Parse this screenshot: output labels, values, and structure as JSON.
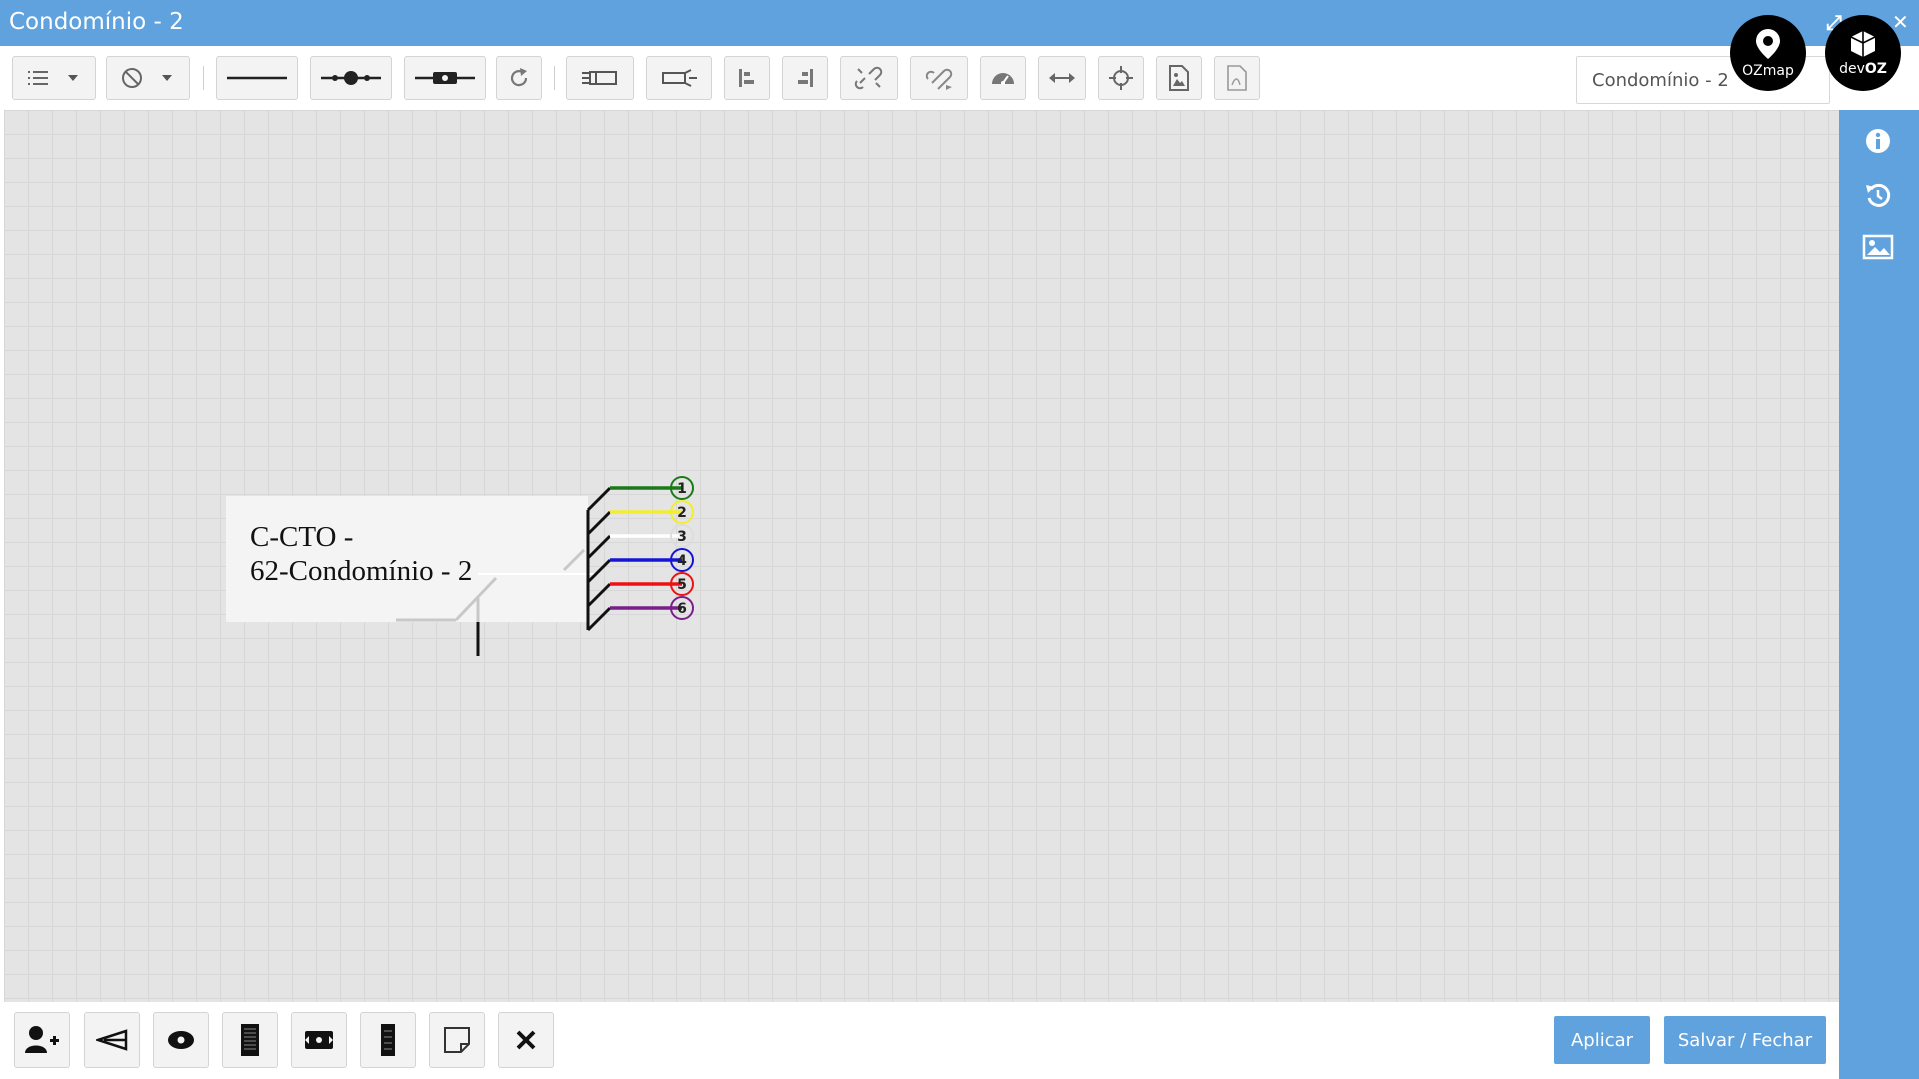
{
  "window": {
    "title": "Condomínio - 2",
    "document_name": "Condomínio - 2"
  },
  "toolbar": {
    "buttons": [
      "list-menu",
      "block-menu",
      "line-tool",
      "splice-line-tool",
      "connector-line-tool",
      "refresh",
      "splitter-tool",
      "connector-tool",
      "align-left",
      "align-right",
      "unlink",
      "relink",
      "dashboard",
      "stretch-horizontal",
      "center",
      "export-image",
      "export-pdf"
    ]
  },
  "logos": {
    "ozmap": "OZmap",
    "devoz_prefix": "dev",
    "devoz_suffix": "OZ"
  },
  "sidebar": {
    "icons": [
      "info-icon",
      "history-icon",
      "image-icon"
    ]
  },
  "diagram": {
    "box_label": "C-CTO -\n62-Condomínio - 2",
    "fibers": [
      {
        "number": "1",
        "color": "#1a7a1a"
      },
      {
        "number": "2",
        "color": "#f2ee2e"
      },
      {
        "number": "3",
        "color": "#ffffff"
      },
      {
        "number": "4",
        "color": "#1515d6"
      },
      {
        "number": "5",
        "color": "#ee1111"
      },
      {
        "number": "6",
        "color": "#7a1e8a"
      }
    ]
  },
  "bottom": {
    "tools": [
      "add-client",
      "splitter",
      "connector",
      "cable-box",
      "cassette",
      "patch-panel",
      "note",
      "delete"
    ],
    "apply_label": "Aplicar",
    "save_close_label": "Salvar / Fechar"
  },
  "colors": {
    "accent": "#5fa2dd",
    "canvas": "#e4e4e4"
  }
}
